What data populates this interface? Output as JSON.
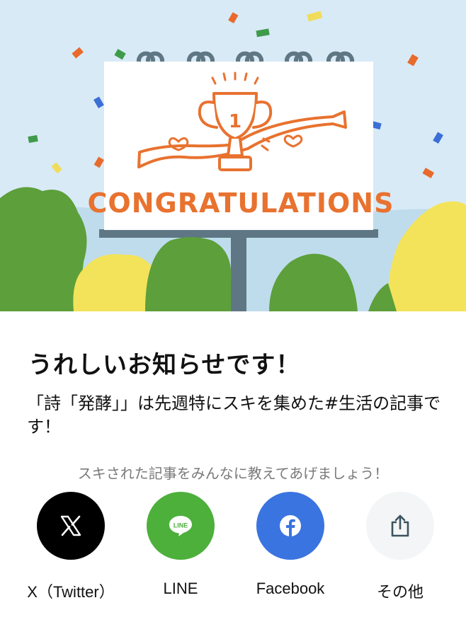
{
  "hero": {
    "banner_text": "CONGRATULATIONS",
    "trophy_number": "1"
  },
  "title": "うれしいお知らせです！",
  "message": "「詩「発酵」」は先週特にスキを集めた#生活の記事です！",
  "share_prompt": "スキされた記事をみんなに教えてあげましょう！",
  "share_options": [
    {
      "label": "X（Twitter）",
      "icon": "x-logo-icon",
      "color": "#000000"
    },
    {
      "label": "LINE",
      "icon": "line-logo-icon",
      "icon_text": "LINE",
      "color": "#4cb03b"
    },
    {
      "label": "Facebook",
      "icon": "facebook-logo-icon",
      "color": "#3a74e0"
    },
    {
      "label": "その他",
      "icon": "share-icon",
      "color": "#f3f5f6"
    }
  ]
}
